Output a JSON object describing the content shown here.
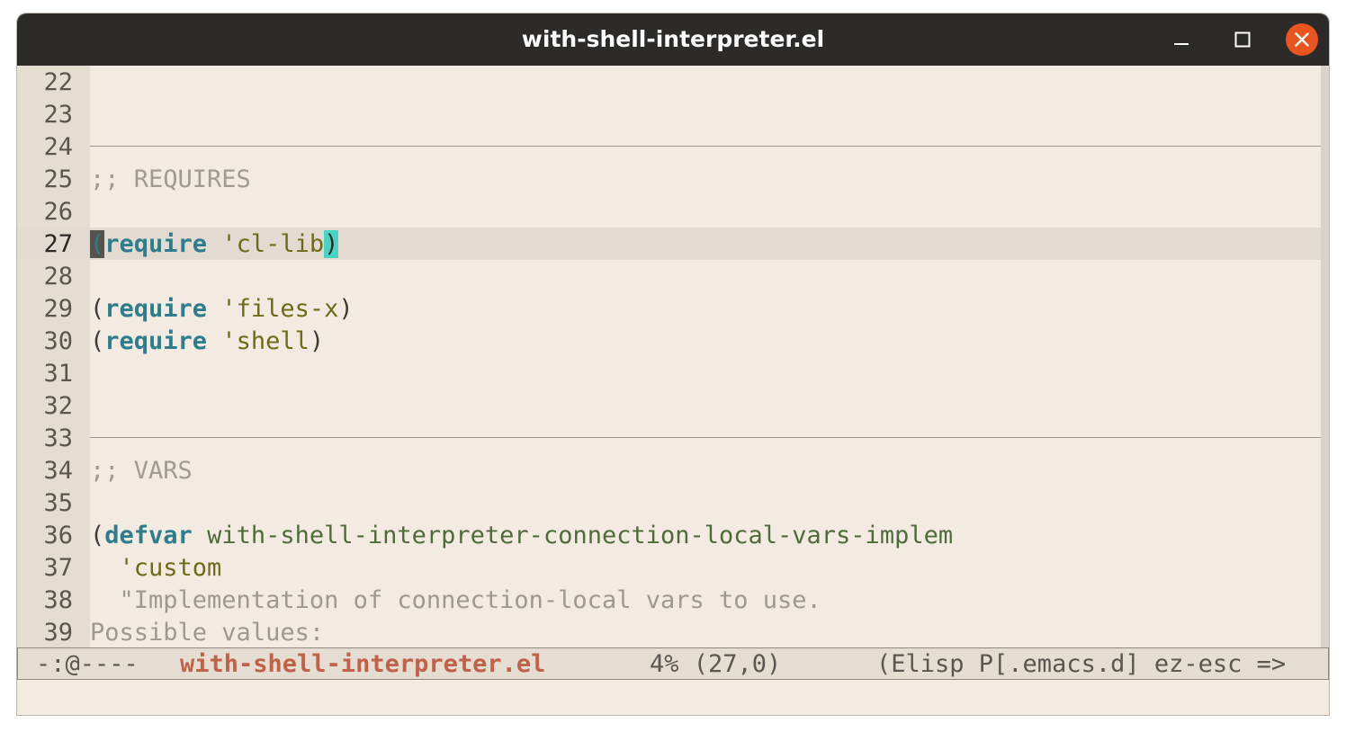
{
  "window": {
    "title": "with-shell-interpreter.el"
  },
  "icons": {
    "minimize": "minimize-icon",
    "maximize": "maximize-icon",
    "close": "close-icon"
  },
  "colors": {
    "titlebar": "#2d2b2a",
    "close_button": "#e95420",
    "background": "#f3ebe1",
    "keyword": "#2f7d8c",
    "buffer_name": "#c0614a",
    "match_paren": "#49d3c3"
  },
  "editor": {
    "lines": [
      {
        "num": "22"
      },
      {
        "num": "23"
      },
      {
        "num": "24"
      },
      {
        "num": "25",
        "comment": ";; REQUIRES"
      },
      {
        "num": "26"
      },
      {
        "num": "27",
        "open": "(",
        "kw": "require",
        "sym": " 'cl-lib",
        "close": ")"
      },
      {
        "num": "28"
      },
      {
        "num": "29",
        "open": "(",
        "kw": "require",
        "sym": " 'files-x",
        "close": ")"
      },
      {
        "num": "30",
        "open": "(",
        "kw": "require",
        "sym": " 'shell",
        "close": ")"
      },
      {
        "num": "31"
      },
      {
        "num": "32"
      },
      {
        "num": "33"
      },
      {
        "num": "34",
        "comment": ";; VARS"
      },
      {
        "num": "35"
      },
      {
        "num": "36",
        "open": "(",
        "kw": "defvar",
        "var": " with-shell-interpreter-connection-local-vars-implem"
      },
      {
        "num": "37",
        "sym": "  'custom"
      },
      {
        "num": "38",
        "str": "  \"Implementation of connection-local vars to use."
      },
      {
        "num": "39",
        "str": "Possible values:"
      }
    ]
  },
  "modeline": {
    "status": "-:@----",
    "buffer_name": "with-shell-interpreter.el",
    "position": "4% (27,0)",
    "modes": "(Elisp P[.emacs.d] ez-esc =>"
  }
}
